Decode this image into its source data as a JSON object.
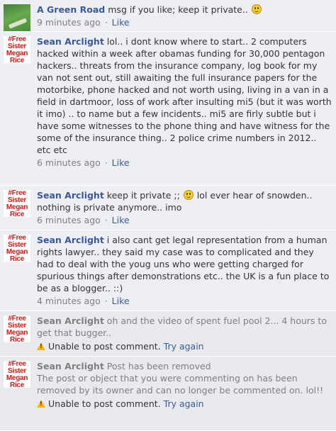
{
  "comments": [
    {
      "author": "A Green Road",
      "text_before": "msg if you like; keep it private..",
      "text_after": "",
      "time": "9 minutes ago",
      "like": "Like"
    },
    {
      "author": "Sean Arclight",
      "text": "lol.. i dont know where to start.. 2 computers hacked within a week after obamas funding for 30,000 pentagon hackers.. threats from the insurance company, log book for my van not sent out, still awaiting the full insurance papers for the motorbike, phone hacked and not worth using, living in a van in a field in dartmoor, loss of work after insulting mi5 (but it was worth it imo) .. to name but a few incidents.. mi5 are firly subtle but i have some witnesses to the phone thing and have witness for the some of the insurance thing.. 2 police crime numbers in 2012.. etc etc",
      "time": "6 minutes ago",
      "like": "Like"
    },
    {
      "author": "Sean Arclight",
      "text_before": "keep it private ;;",
      "text_after": "lol ever hear of snowden.. nothing is private anymore.. imo",
      "time": "6 minutes ago",
      "like": "Like"
    },
    {
      "author": "Sean Arclight",
      "text": "i also cant get legal representation from a human rights lawyer.. they said my case was to complicated and they had to deal with the youg uns who were getting charged for spurious things after demonstrations etc.. the UK is a fun place to be as a blogger.. ::)",
      "time": "4 minutes ago",
      "like": "Like"
    },
    {
      "author": "Sean Arclight",
      "text": "oh and the video of spent fuel pool 2... 4 hours to get that bugger..",
      "error": "Unable to post comment.",
      "retry": "Try again"
    },
    {
      "author": "Sean Arclight",
      "text": "Post has been removed",
      "removed_note": "The post or object that you were commenting on has been removed by its owner and can no longer be commented on. lol!!",
      "error": "Unable to post comment.",
      "retry": "Try again"
    }
  ],
  "avatar_sister_lines": [
    "#Free",
    "Sister",
    "Megan",
    "Rice"
  ],
  "icons": {
    "smiley": "smiley-emoticon-icon",
    "warning": "warning-triangle-icon"
  },
  "colors": {
    "background": "#edeff4",
    "author_link": "#3b5998",
    "meta_gray": "#7f7f7f",
    "warning": "#f2b51c",
    "avatar_text": "#cc1a1a"
  }
}
